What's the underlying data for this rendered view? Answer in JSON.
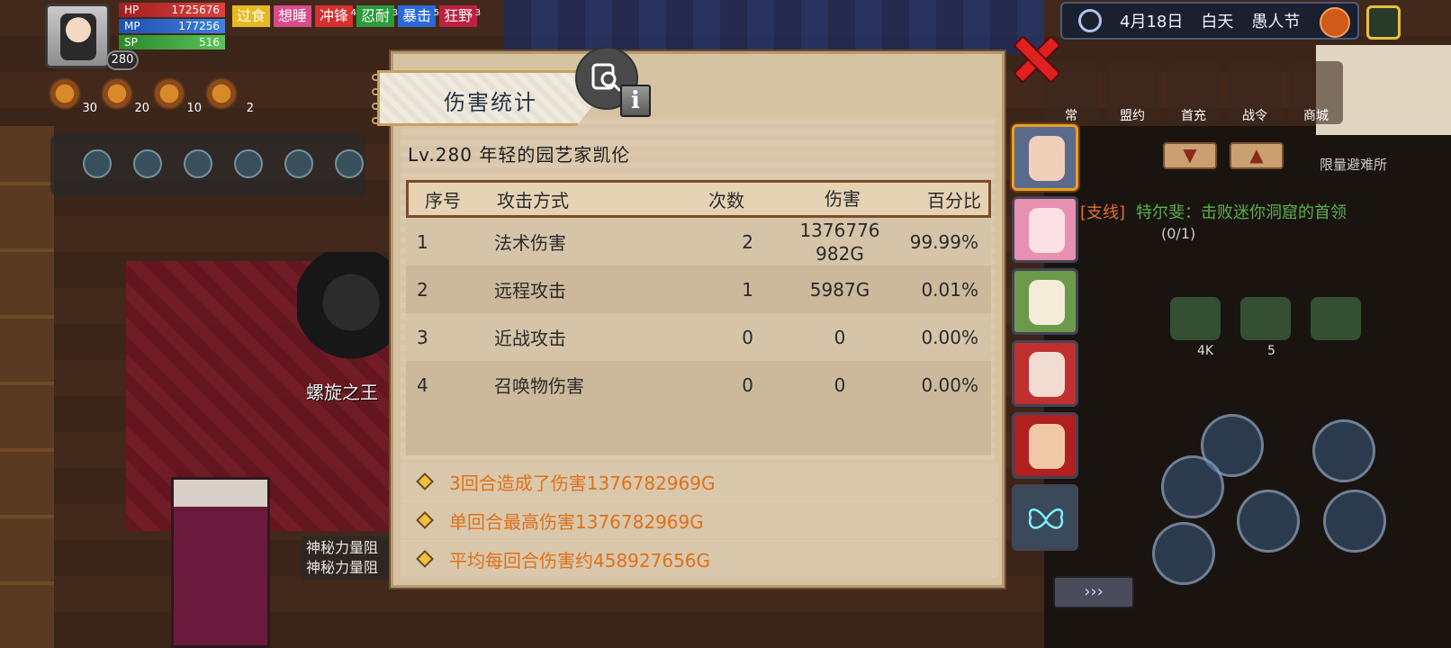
{
  "hud": {
    "level": "280",
    "hp_label": "HP",
    "hp_value": "1725676",
    "mp_label": "MP",
    "mp_value": "177256",
    "sp_label": "SP",
    "sp_value": "516",
    "buffs": [
      {
        "label": "过食",
        "color": "#e8b820",
        "count": ""
      },
      {
        "label": "想睡",
        "color": "#d84a8a",
        "count": ""
      },
      {
        "label": "冲锋",
        "color": "#d83030",
        "count": "4"
      },
      {
        "label": "忍耐",
        "color": "#2a9a3a",
        "count": "3"
      },
      {
        "label": "暴击",
        "color": "#2a6ad8",
        "count": "5"
      },
      {
        "label": "狂野",
        "color": "#c02040",
        "count": "3"
      }
    ],
    "skill_counts": [
      "30",
      "20",
      "10",
      "2"
    ]
  },
  "topbar": {
    "date": "4月18日",
    "daytime": "白天",
    "festival": "愚人节"
  },
  "menu": [
    "常",
    "盟约",
    "首充",
    "战令",
    "商城"
  ],
  "menu_badge": "SHOP",
  "side": {
    "shelter": "限量避难所",
    "quest_tag": "[支线]",
    "quest": "特尔斐：击败迷你洞窟的首领",
    "quest_progress": "(0/1)",
    "exp_label": "Exp",
    "exp_count": "4K",
    "item_count": "5"
  },
  "scene": {
    "boss_name": "螺旋之王",
    "mystic_lines": [
      "神秘力量阻",
      "神秘力量阻"
    ]
  },
  "dialog": {
    "title": "伤害统计",
    "character": "Lv.280  年轻的园艺家凯伦",
    "columns": {
      "idx": "序号",
      "type": "攻击方式",
      "count": "次数",
      "damage": "伤害",
      "percent": "百分比"
    },
    "rows": [
      {
        "idx": "1",
        "type": "法术伤害",
        "count": "2",
        "damage": "1376776982G",
        "percent": "99.99%"
      },
      {
        "idx": "2",
        "type": "远程攻击",
        "count": "1",
        "damage": "5987G",
        "percent": "0.01%"
      },
      {
        "idx": "3",
        "type": "近战攻击",
        "count": "0",
        "damage": "0",
        "percent": "0.00%"
      },
      {
        "idx": "4",
        "type": "召唤物伤害",
        "count": "0",
        "damage": "0",
        "percent": "0.00%"
      }
    ],
    "summary": [
      "3回合造成了伤害1376782969G",
      "单回合最高伤害1376782969G",
      "平均每回合伤害约458927656G"
    ]
  },
  "portraits": [
    {
      "name": "portrait-gardener-karen",
      "color": "#5a6a8a",
      "face": "#f0d0b8",
      "active": true
    },
    {
      "name": "portrait-pink-nurse",
      "color": "#e890b0",
      "face": "#fbe0e6",
      "active": false
    },
    {
      "name": "portrait-green-flower",
      "color": "#6a9a4a",
      "face": "#f4ecd8",
      "active": false
    },
    {
      "name": "portrait-red-priestess",
      "color": "#c03030",
      "face": "#f0dcd0",
      "active": false
    },
    {
      "name": "portrait-pirate-captain",
      "color": "#b02020",
      "face": "#f0c8a8",
      "active": false
    },
    {
      "name": "portrait-butterfly",
      "color": "#3a4a5a",
      "face": "",
      "active": false
    }
  ]
}
